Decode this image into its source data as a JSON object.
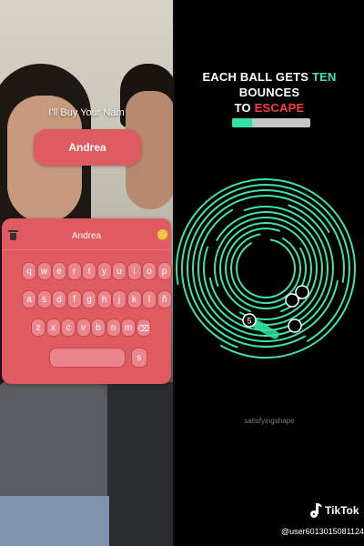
{
  "overlay": {
    "prompt": "I'll Buy Your Nam",
    "name_pill": "Andrea"
  },
  "keyboard": {
    "input_value": "Andrea",
    "rows": [
      [
        "q",
        "w",
        "e",
        "r",
        "t",
        "y",
        "u",
        "i",
        "o",
        "p"
      ],
      [
        "a",
        "s",
        "d",
        "f",
        "g",
        "h",
        "j",
        "k",
        "l",
        "ñ"
      ],
      [
        "z",
        "x",
        "c",
        "v",
        "b",
        "n",
        "m",
        "⌫"
      ]
    ],
    "send_key": "s",
    "colors": {
      "panel": "#e05a62",
      "key": "#ea858b",
      "coin": "#f5c542"
    }
  },
  "game": {
    "headline_1a": "EACH BALL GETS ",
    "headline_1b": "TEN",
    "headline_1c": " BOUNCES",
    "headline_2a": "TO ",
    "headline_2b": "ESCAPE",
    "progress_fraction": 0.25,
    "ball_count_label": "5",
    "watermark": "satisfyingshape",
    "colors": {
      "ring": "#3ee3a7",
      "accent_green": "#3ee3a7",
      "accent_red": "#ff3b3b"
    }
  },
  "footer": {
    "brand": "TikTok",
    "handle": "@user6013015081124"
  }
}
